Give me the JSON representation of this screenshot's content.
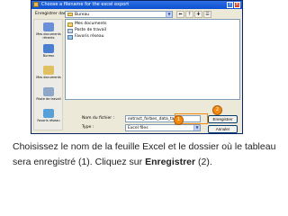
{
  "dialog": {
    "title": "Choose a filename for the excel export",
    "save_in_label": "Enregistrer dans :",
    "save_in_value": "Bureau",
    "places": [
      {
        "label": "Mes documents récents",
        "color": "#6b8fd6"
      },
      {
        "label": "Bureau",
        "color": "#4a7fd0"
      },
      {
        "label": "Mes documents",
        "color": "#e0c060"
      },
      {
        "label": "Poste de travail",
        "color": "#8fa8c8"
      },
      {
        "label": "Favoris réseau",
        "color": "#5aa0d8"
      }
    ],
    "files": [
      {
        "label": "Mes documents",
        "icon": "folder-icon"
      },
      {
        "label": "Poste de travail",
        "icon": "computer-icon"
      },
      {
        "label": "Favoris réseau",
        "icon": "network-icon"
      }
    ],
    "filename_label": "Nom du fichier :",
    "filename_value": "extract_forbes_data_tablea",
    "type_label": "Type :",
    "type_value": "Excel files",
    "save_button": "Enregistrer",
    "cancel_button": "Annuler"
  },
  "markers": {
    "one": "1",
    "two": "2"
  },
  "caption": {
    "text_part1": "Choisissez le nom de la feuille Excel et le dossier où le tableau sera enregistré (1). Cliquez sur ",
    "bold": "Enregistrer",
    "text_part2": " (2)."
  },
  "colors": {
    "accent": "#f28a12",
    "titlebar": "#0b4fd1",
    "dialog_bg": "#ece9d8"
  }
}
